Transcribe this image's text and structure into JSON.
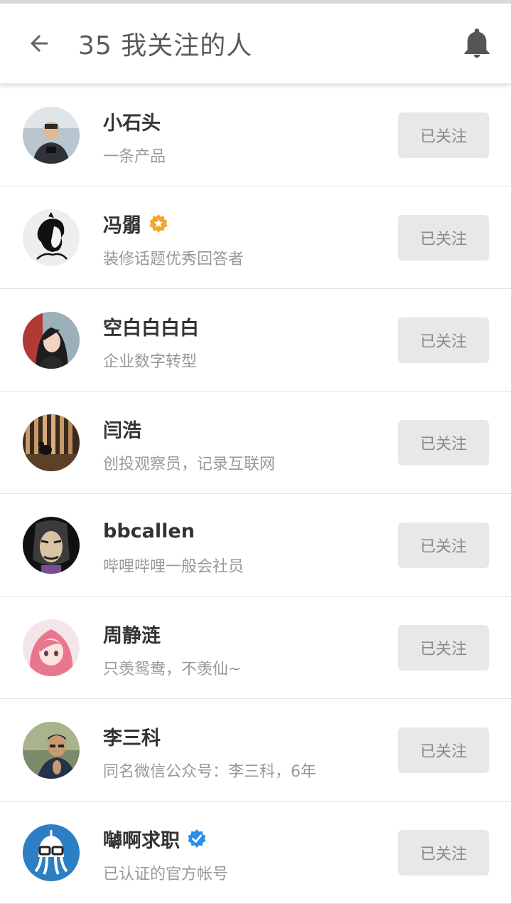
{
  "header": {
    "title": "35 我关注的人",
    "back_icon": "arrow-left-icon",
    "bell_icon": "bell-icon"
  },
  "users": [
    {
      "name": "小石头",
      "desc": "一条产品",
      "button": "已关注",
      "badge": ""
    },
    {
      "name": "冯朤",
      "desc": "装修话题优秀回答者",
      "button": "已关注",
      "badge": "orange-star-badge"
    },
    {
      "name": "空白白白白",
      "desc": "企业数字转型",
      "button": "已关注",
      "badge": ""
    },
    {
      "name": "闫浩",
      "desc": "创投观察员，记录互联网",
      "button": "已关注",
      "badge": ""
    },
    {
      "name": "bbcallen",
      "desc": "哔哩哔哩一般会社员",
      "button": "已关注",
      "badge": ""
    },
    {
      "name": "周静涟",
      "desc": "只羡鸳鸯，不羡仙~",
      "button": "已关注",
      "badge": ""
    },
    {
      "name": "李三科",
      "desc": "同名微信公众号：李三科，6年",
      "button": "已关注",
      "badge": ""
    },
    {
      "name": "嚹啊求职",
      "desc": "已认证的官方帐号",
      "button": "已关注",
      "badge": "blue-verified-badge"
    }
  ],
  "colors": {
    "orange_badge": "#f5a623",
    "blue_badge": "#2b8ee8",
    "button_bg": "#e8e8e8",
    "button_text": "#8a8a8a"
  }
}
